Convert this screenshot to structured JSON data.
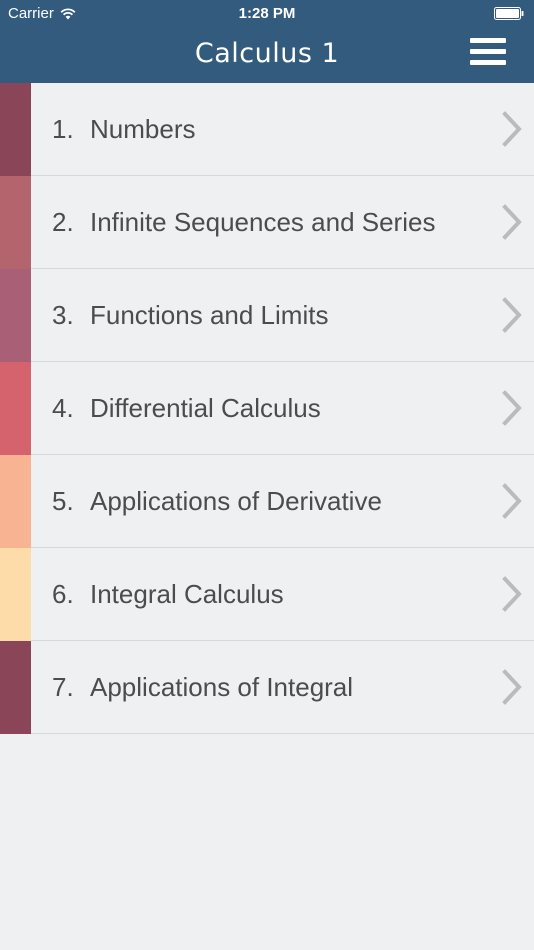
{
  "status_bar": {
    "carrier": "Carrier",
    "time": "1:28 PM",
    "wifi_icon": "wifi-icon",
    "battery_icon": "battery-icon"
  },
  "nav": {
    "title": "Calculus 1",
    "menu_icon": "hamburger-menu-icon"
  },
  "colors": {
    "header_bg": "#335b7e",
    "page_bg": "#eff0f1",
    "text": "#4a4c4f",
    "chevron": "#b9bbbe"
  },
  "chapters": [
    {
      "number": "1.",
      "title": "Numbers",
      "color": "#8b4558"
    },
    {
      "number": "2.",
      "title": "Infinite Sequences and Series",
      "color": "#b3646d"
    },
    {
      "number": "3.",
      "title": "Functions and Limits",
      "color": "#a95f76"
    },
    {
      "number": "4.",
      "title": "Differential Calculus",
      "color": "#d4636d"
    },
    {
      "number": "5.",
      "title": "Applications of Derivative",
      "color": "#f8b392"
    },
    {
      "number": "6.",
      "title": "Integral Calculus",
      "color": "#fddcaa"
    },
    {
      "number": "7.",
      "title": "Applications of Integral",
      "color": "#8b4558"
    }
  ]
}
